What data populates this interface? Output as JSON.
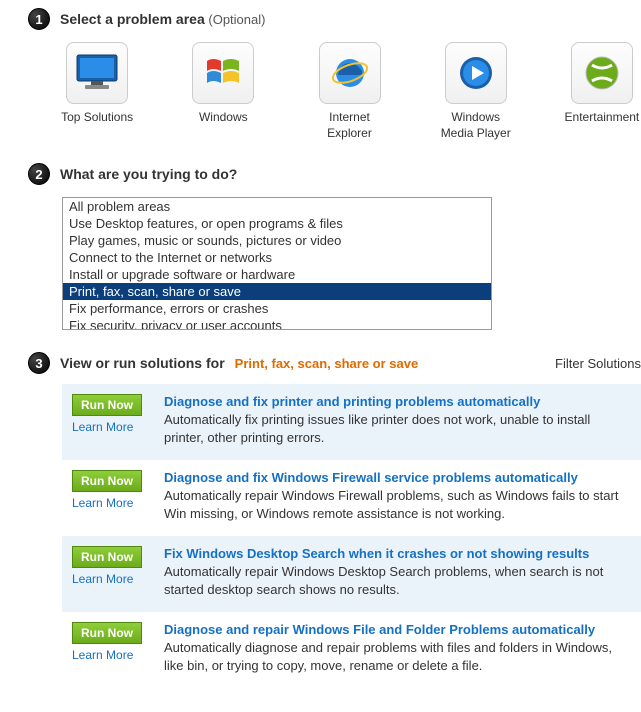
{
  "step1": {
    "title": "Select a problem area",
    "optional": "(Optional)",
    "tiles": [
      {
        "label": "Top Solutions",
        "icon": "monitor"
      },
      {
        "label": "Windows",
        "icon": "windows"
      },
      {
        "label": "Internet Explorer",
        "icon": "ie"
      },
      {
        "label": "Windows Media Player",
        "icon": "wmp"
      },
      {
        "label": "Entertainment",
        "icon": "xbox"
      }
    ]
  },
  "step2": {
    "title": "What are you trying to do?",
    "items": [
      "All problem areas",
      "Use Desktop features, or open programs & files",
      "Play games, music or sounds, pictures or video",
      "Connect to the Internet or networks",
      "Install or upgrade software or hardware",
      "Print, fax, scan, share or save",
      "Fix performance, errors or crashes",
      "Fix security, privacy or user accounts"
    ],
    "selected_index": 5
  },
  "step3": {
    "title_prefix": "View or run solutions for",
    "topic": "Print, fax, scan, share or save",
    "filter_label": "Filter Solutions",
    "run_now_label": "Run Now",
    "learn_more_label": "Learn More",
    "solutions": [
      {
        "title": "Diagnose and fix printer and printing problems automatically",
        "desc": "Automatically fix printing issues like printer does not work, unable to install printer, other printing errors."
      },
      {
        "title": "Diagnose and fix Windows Firewall service problems automatically",
        "desc": "Automatically repair Windows Firewall problems, such as Windows fails to start Win missing, or Windows remote assistance is not working."
      },
      {
        "title": "Fix Windows Desktop Search when it crashes or not showing results",
        "desc": "Automatically repair Windows Desktop Search problems, when search is not started desktop search shows no results."
      },
      {
        "title": "Diagnose and repair Windows File and Folder Problems automatically",
        "desc": "Automatically diagnose and repair problems with files and folders in Windows, like bin, or trying to copy, move, rename or delete a file."
      }
    ]
  }
}
